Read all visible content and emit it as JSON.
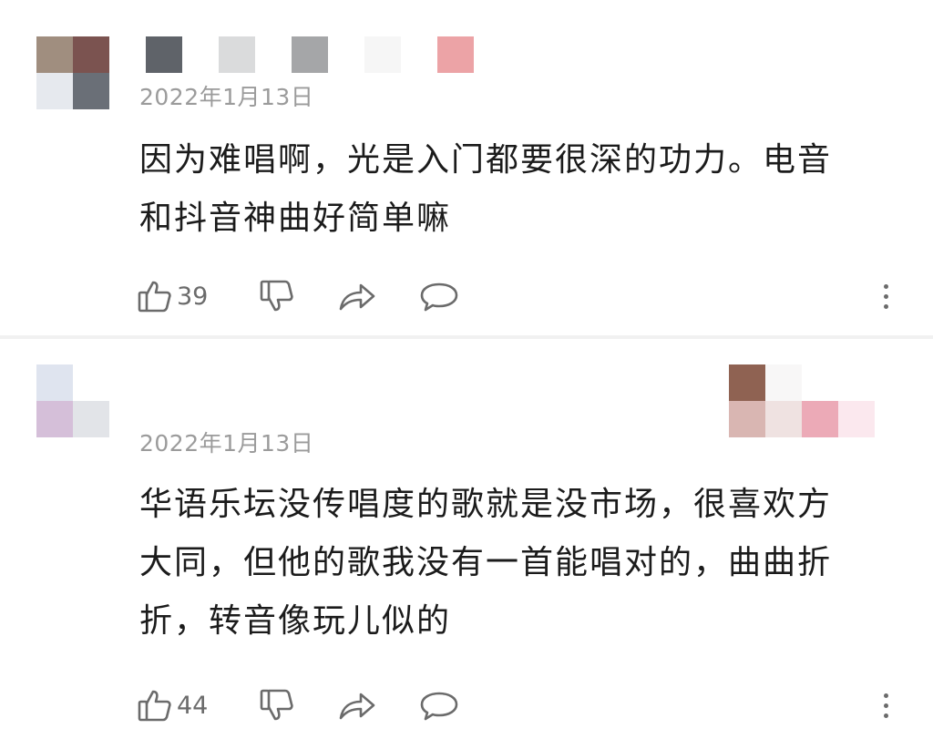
{
  "comments": [
    {
      "date": "2022年1月13日",
      "text_line1": "因为难唱啊，光是入门都要很深的功力。电音",
      "text_line2": "和抖音神曲好简单嘛",
      "text_line3": "",
      "likes": "39",
      "avatar_colors": [
        "#a08e7f",
        "#7b5350",
        "#e6e9ee",
        "#6a6f77"
      ],
      "name_colors": [
        "#5f6369",
        "#dadbdc",
        "#a5a6a8",
        "#f6f6f6",
        "#eca3a6"
      ]
    },
    {
      "date": "2022年1月13日",
      "text_line1": "华语乐坛没传唱度的歌就是没市场，很喜欢方",
      "text_line2": "大同，但他的歌我没有一首能唱对的，曲曲折",
      "text_line3": "折，转音像玩儿似的",
      "likes": "44",
      "avatar_colors": [
        "#dfe4ef",
        "#ffffff",
        "#d5bfd9",
        "#e2e4e8"
      ],
      "badge_colors": [
        "#8f6252",
        "#f8f7f7",
        "#ffffff",
        "#ffffff",
        "#d9b6b2",
        "#efe2e1",
        "#ecaab7",
        "#fbe8ee"
      ]
    }
  ],
  "icons": {
    "like": "thumbs-up-icon",
    "dislike": "thumbs-down-icon",
    "share": "share-icon",
    "reply": "comment-icon",
    "more": "more-options-icon"
  }
}
